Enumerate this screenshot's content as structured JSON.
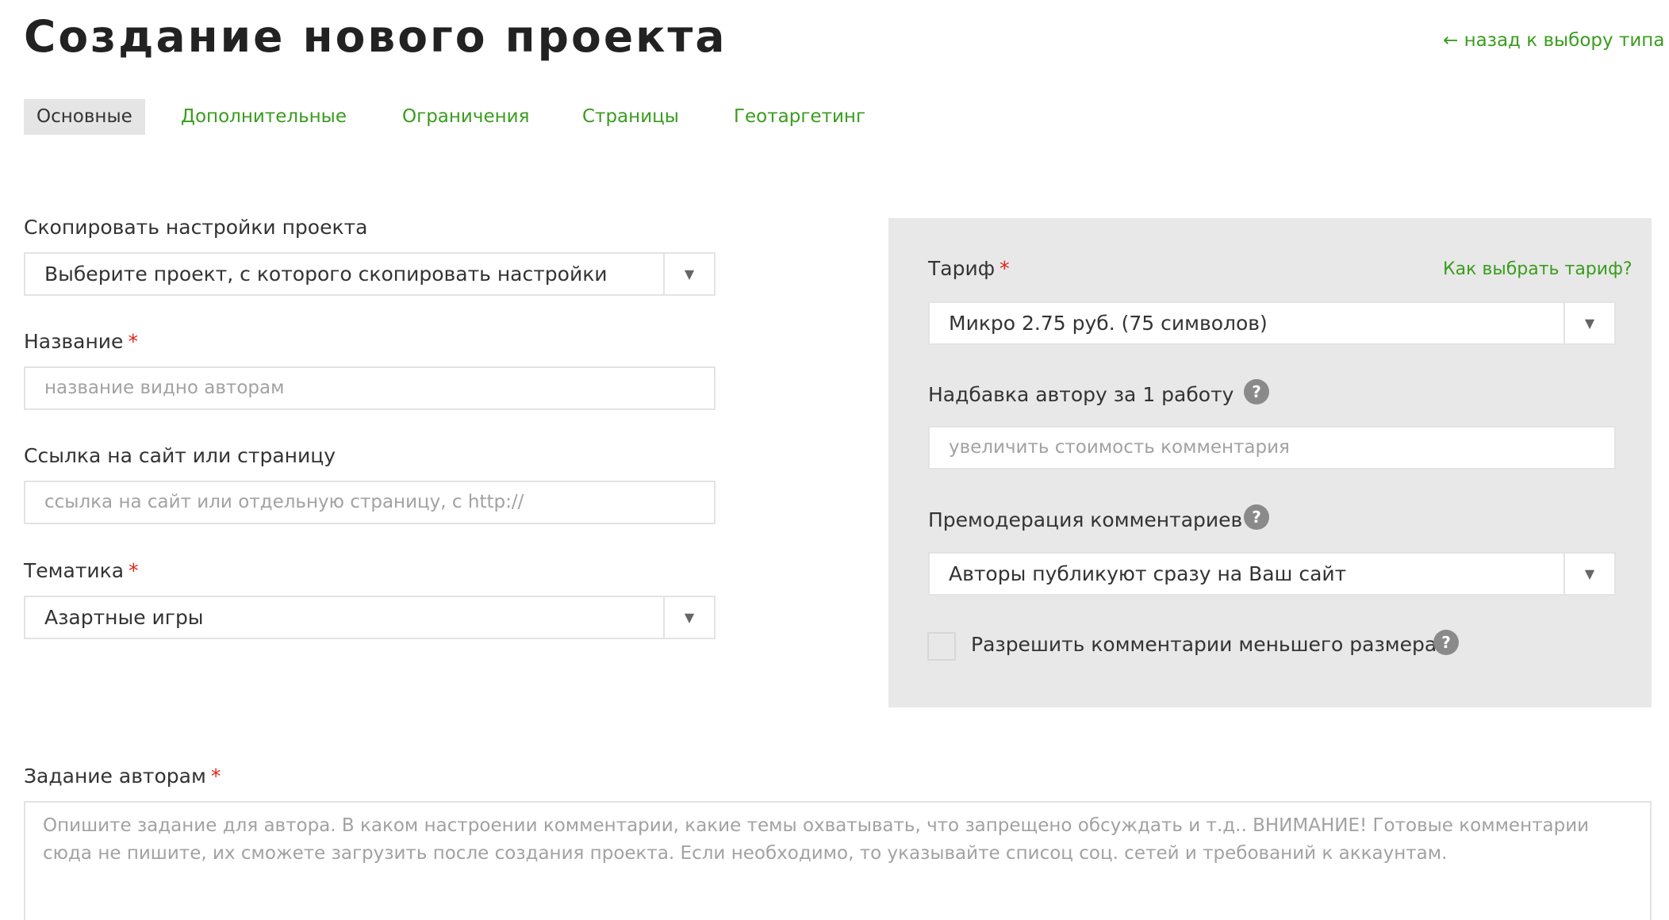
{
  "header": {
    "title": "Создание нового проекта",
    "back_link": "← назад к выбору типа"
  },
  "tabs": [
    {
      "label": "Основные",
      "active": true
    },
    {
      "label": "Дополнительные",
      "active": false
    },
    {
      "label": "Ограничения",
      "active": false
    },
    {
      "label": "Страницы",
      "active": false
    },
    {
      "label": "Геотаргетинг",
      "active": false
    }
  ],
  "form": {
    "copy_settings": {
      "label": "Скопировать настройки проекта",
      "value": "Выберите проект, с которого скопировать настройки"
    },
    "name": {
      "label": "Название",
      "required_mark": "*",
      "placeholder": "название видно авторам"
    },
    "link": {
      "label": "Ссылка на сайт или страницу",
      "placeholder": "ссылка на сайт или отдельную страницу, с http://"
    },
    "topic": {
      "label": "Тематика",
      "required_mark": "*",
      "value": "Азартные игры"
    },
    "task": {
      "label": "Задание авторам",
      "required_mark": "*",
      "placeholder": "Опишите задание для автора. В каком настроении комментарии, какие темы охватывать, что запрещено обсуждать и т.д.. ВНИМАНИЕ! Готовые комментарии сюда не пишите, их сможете загрузить после создания проекта. Если необходимо, то указывайте списоц соц. сетей и требований к аккаунтам."
    }
  },
  "panel": {
    "tariff": {
      "label": "Тариф",
      "required_mark": "*",
      "help_link": "Как выбрать тариф?",
      "value": "Микро 2.75 руб. (75 символов)"
    },
    "bonus": {
      "label": "Надбавка автору за 1 работу",
      "placeholder": "увеличить стоимость комментария"
    },
    "premoderation": {
      "label": "Премодерация комментариев",
      "value": "Авторы публикуют сразу на Ваш сайт"
    },
    "allow_smaller": {
      "label": "Разрешить комментарии меньшего размера",
      "checked": false
    }
  },
  "icons": {
    "help": "?",
    "dropdown": "▼"
  },
  "colors": {
    "accent_green": "#3a9c1e",
    "required_red": "#e2231a",
    "panel_bg": "#e8e8e8",
    "active_tab_bg": "#e5e5e5"
  }
}
